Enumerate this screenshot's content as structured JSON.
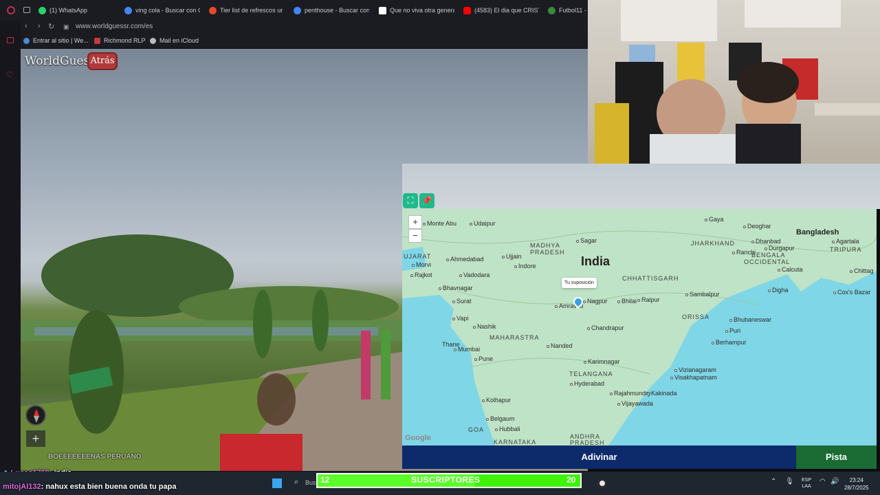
{
  "browser": {
    "tabs": [
      {
        "label": "(1) WhatsApp",
        "color": "#25d366"
      },
      {
        "label": "ving cola - Buscar con G",
        "color": "#4285f4"
      },
      {
        "label": "Tier list de refrescos ur",
        "color": "#e34c26"
      },
      {
        "label": "penthouse - Buscar con",
        "color": "#4285f4"
      },
      {
        "label": "Que no viva otra genera",
        "color": "#ffffff"
      },
      {
        "label": "(4583) El dia que CRIST",
        "color": "#ff0000"
      },
      {
        "label": "Futbol11 - D",
        "color": "#3a8a3a"
      }
    ],
    "url": "www.worldguessr.com/es",
    "bookmarks": [
      {
        "label": "Entrar al sitio | We...",
        "color": "#4a8cd6"
      },
      {
        "label": "Richmond RLP",
        "color": "#c43b3b"
      },
      {
        "label": "Mail en iCloud",
        "color": "#bbbbbb"
      }
    ]
  },
  "game": {
    "logo": "WorldGuessr",
    "back_label": "Atrás",
    "guess_button": "Adivinar",
    "hint_button": "Pista",
    "sv_zoom_plus": "+"
  },
  "map": {
    "zoom_in": "+",
    "zoom_out": "−",
    "guess_tooltip": "Tu suposición",
    "google": "Google",
    "country": "India",
    "labels": {
      "monte_abu": "Monte Abu",
      "udaipur": "Udaipur",
      "sagar": "Sagar",
      "gaya": "Gaya",
      "deoghar": "Deoghar",
      "madhya": "MADHYA",
      "pradesh": "PRADESH",
      "jharkhand": "JHARKHAND",
      "dhanbad": "Dhanbad",
      "bangladesh": "Bangladesh",
      "ujarat": "UJARAT",
      "ahmedabad": "Ahmedabad",
      "ujjain": "Ujjain",
      "indore": "Indore",
      "ranchi": "Ranchi",
      "durgapur": "Durgapur",
      "west_bengal": "BENGALA",
      "occidental": "OCCIDENTAL",
      "agartala": "Agartala",
      "tripura": "TRIPURA",
      "morvi": "Morvi",
      "rajkot": "Rajkot",
      "vadodara": "Vadodara",
      "chhattisgarh": "CHHATTISGARH",
      "calcuta": "Calcuta",
      "chittag": "Chittag",
      "bhavnagar": "Bhavnagar",
      "surat": "Surat",
      "amravati": "Amravati",
      "nagpur": "Nagpur",
      "bhilai": "Bhilai",
      "raipur": "Raipur",
      "sambalpur": "Sambalpur",
      "digha": "Digha",
      "coxs": "Cox's Bazar",
      "vapi": "Vapi",
      "odisha": "ORISSA",
      "bhubaneswar": "Bhubaneswar",
      "nashik": "Nashik",
      "chandrapur": "Chandrapur",
      "puri": "Puri",
      "maharastra": "MAHARASTRA",
      "thane": "Thane",
      "mumbai": "Mumbai",
      "nanded": "Nanded",
      "berhampur": "Berhampur",
      "pune": "Pune",
      "karimnagar": "Karimnagar",
      "telangana": "TELANGANA",
      "vizianagaram": "Vizianagaram",
      "hyderabad": "Hyderabad",
      "visakhapatnam": "Visakhapatnam",
      "rajahmundry": "Rajahmundry",
      "kakinada": "Kakinada",
      "kolhapur": "Kolhapur",
      "vijayawada": "Vijayawada",
      "belgaum": "Belgaum",
      "goa": "GOA",
      "hubbali": "Hubbali",
      "andhra": "ANDHRA",
      "andhra2": "PRADESH",
      "karnataka": "KARNATAKA"
    }
  },
  "chat": {
    "faded": "BOEEEEEEENAS PERUANO",
    "messages": [
      {
        "user": "Lucas1719",
        "text": ": india"
      },
      {
        "user": "mitojAl132",
        "text": ": nahux esta bien buena onda tu papa"
      }
    ]
  },
  "stream": {
    "subs_count": "12",
    "subs_label": "SUSCRIPTORES",
    "subs_goal": "20",
    "subs_progress": 0.6
  },
  "taskbar": {
    "search": "Bus",
    "lang1": "ESP",
    "lang2": "LAA",
    "time": "23:24",
    "date": "28/7/2025"
  },
  "colors": {
    "accent": "#1fb98a",
    "guess_bg": "#0d2a6b",
    "hint_bg": "#1a6b34",
    "back_bg": "#b03a3a",
    "subs_bar": "#3ef20a",
    "sea": "#7fd6e6"
  }
}
